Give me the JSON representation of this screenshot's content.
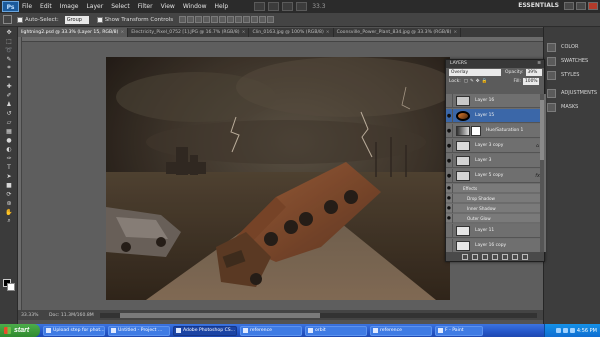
{
  "app": {
    "logo_text": "Ps",
    "workspace": "ESSENTIALS",
    "zoom_readout": "33.3"
  },
  "menu": [
    "File",
    "Edit",
    "Image",
    "Layer",
    "Select",
    "Filter",
    "View",
    "Window",
    "Help"
  ],
  "options_bar": {
    "auto_select_label": "Auto-Select:",
    "auto_select_value": "Group",
    "show_transform_label": "Show Transform Controls"
  },
  "tools": [
    "move",
    "marquee",
    "lasso",
    "quick-select",
    "crop",
    "eyedropper",
    "healing",
    "brush",
    "clone-stamp",
    "history-brush",
    "eraser",
    "gradient",
    "blur",
    "dodge",
    "pen",
    "type",
    "path-select",
    "shape",
    "3d-rotate",
    "3d-orbit",
    "hand",
    "zoom"
  ],
  "doc_tabs": [
    {
      "label": "lightning2.psd @ 33.3% (Layer 15, RGB/8)",
      "active": true
    },
    {
      "label": "Electricity_Pixel_0752 [1].JPG @ 16.7% (RGB/8)",
      "active": false
    },
    {
      "label": "Clin_0163.jpg @ 100% (RGB/8)",
      "active": false
    },
    {
      "label": "Coonsville_Power_Plant_834.jpg @ 33.3% (RGB/8)",
      "active": false
    }
  ],
  "status": {
    "zoom": "33.33%",
    "doc_size": "Doc: 11.3M/160.8M"
  },
  "dock": {
    "items": [
      {
        "label": "COLOR",
        "icon": "color-icon"
      },
      {
        "label": "SWATCHES",
        "icon": "swatches-icon"
      },
      {
        "label": "STYLES",
        "icon": "styles-icon"
      },
      {
        "label": "ADJUSTMENTS",
        "icon": "adjustments-icon"
      },
      {
        "label": "MASKS",
        "icon": "masks-icon"
      }
    ]
  },
  "layers_panel": {
    "title": "LAYERS",
    "blend_mode": "Overlay",
    "opacity_label": "Opacity:",
    "opacity_value": "39%",
    "lock_label": "Lock:",
    "fill_label": "Fill:",
    "fill_value": "100%",
    "layers": [
      {
        "name": "Layer 16",
        "visible": false,
        "selected": false
      },
      {
        "name": "Layer 15",
        "visible": true,
        "selected": true
      },
      {
        "name": "Hue/Saturation 1",
        "visible": true,
        "selected": false
      },
      {
        "name": "Layer 3 copy",
        "visible": true,
        "selected": false
      },
      {
        "name": "Layer 3",
        "visible": true,
        "selected": false
      },
      {
        "name": "Layer 5 copy",
        "visible": true,
        "selected": false
      }
    ],
    "effects_label": "Effects",
    "effects": [
      "Drop Shadow",
      "Inner Shadow",
      "Outer Glow"
    ],
    "layers_below": [
      {
        "name": "Layer 11",
        "visible": false
      },
      {
        "name": "Layer 16 copy",
        "visible": false
      },
      {
        "name": "Layer 1",
        "visible": false
      }
    ],
    "fx_symbol": "fx"
  },
  "taskbar": {
    "start_label": "start",
    "tasks": [
      {
        "label": "Upload step for phot...",
        "active": false
      },
      {
        "label": "Untitled - Project ...",
        "active": false
      },
      {
        "label": "Adobe Photoshop CS...",
        "active": true
      },
      {
        "label": "reference",
        "active": false
      },
      {
        "label": "orbit",
        "active": false
      },
      {
        "label": "reference",
        "active": false
      },
      {
        "label": "F - Paint",
        "active": false
      }
    ],
    "clock": "4:56 PM"
  },
  "colors": {
    "selected_layer": "#3b67a8",
    "taskbar": "#2456c8",
    "start_button": "#3f9b3d"
  }
}
